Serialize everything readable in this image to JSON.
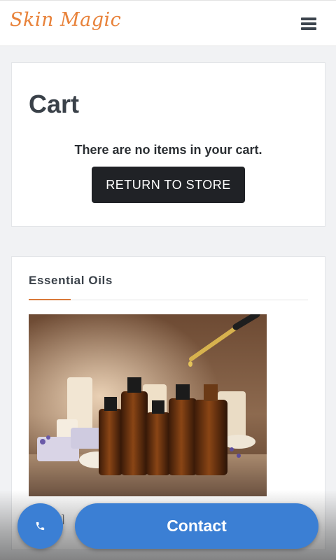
{
  "header": {
    "logo_text": "Skin Magic",
    "menu_icon": "hamburger-menu-icon"
  },
  "cart": {
    "title": "Cart",
    "empty_message": "There are no items in your cart.",
    "return_button": "RETURN TO STORE"
  },
  "essential_oils": {
    "title": "Essential Oils",
    "caption": "[cart]"
  },
  "footer": {
    "contact_button": "Contact",
    "call_icon": "phone-icon"
  },
  "colors": {
    "logo": "#e8823a",
    "accent": "#d9793a",
    "primary_button": "#202226",
    "contact_blue": "#3b7fd4",
    "page_bg": "#f1f2f4"
  }
}
